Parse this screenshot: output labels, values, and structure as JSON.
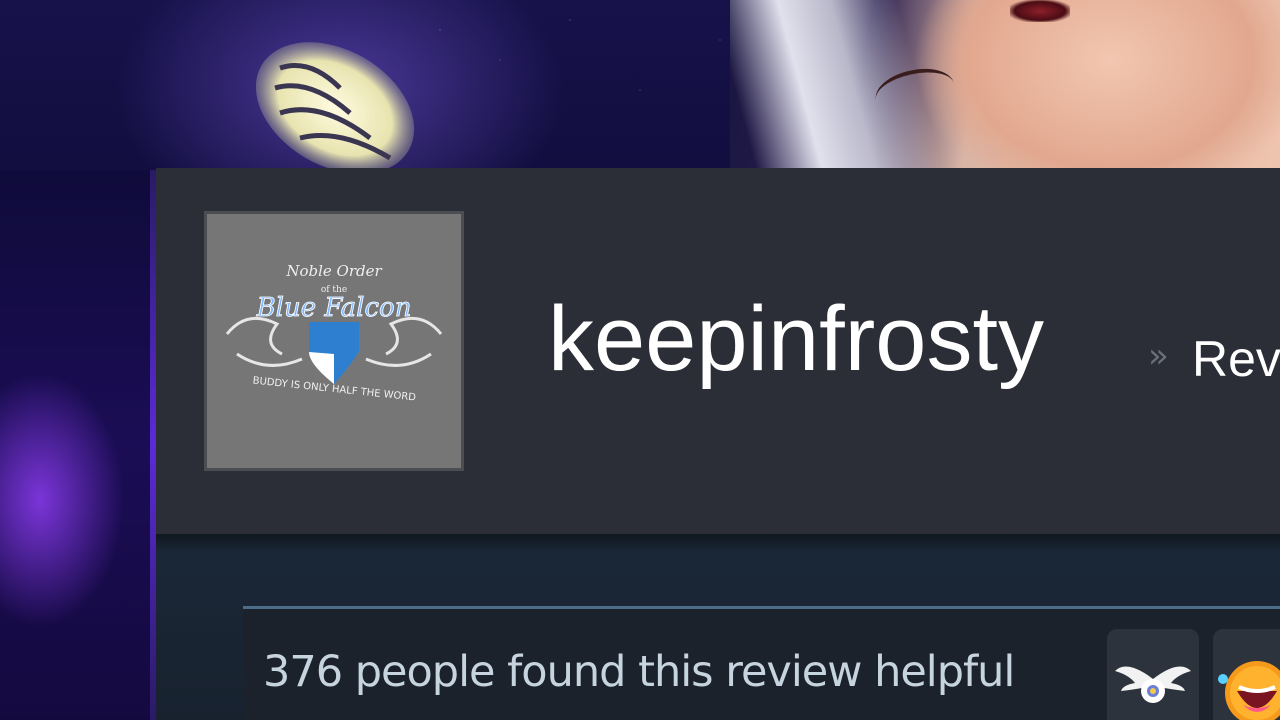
{
  "profile": {
    "persona_name": "keepinfrosty",
    "breadcrumb_separator": "»",
    "breadcrumb_link": "Rev"
  },
  "avatar": {
    "emblem_line1": "Noble Order",
    "emblem_line2": "of the",
    "emblem_title": "Blue Falcon",
    "emblem_motto": "BUDDY IS ONLY HALF THE WORD"
  },
  "review": {
    "helpful_text": "376 people found this review helpful"
  },
  "icons": {
    "award_1": "winged-emblem-icon",
    "award_2": "laughing-face-icon"
  },
  "colors": {
    "header_bg": "#2b2e36",
    "review_bg": "#1b2838",
    "text_light": "#c6d4df",
    "accent_border": "#4d6c8a"
  }
}
